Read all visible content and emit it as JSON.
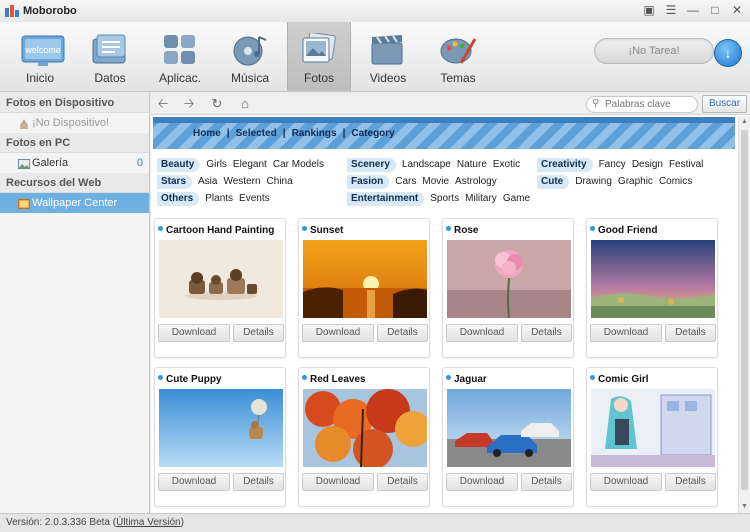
{
  "app": {
    "title": "Moborobo"
  },
  "toolbar": {
    "items": [
      {
        "label": "Inicio",
        "icon": "welcome-icon"
      },
      {
        "label": "Datos",
        "icon": "contacts-icon"
      },
      {
        "label": "Aplicac.",
        "icon": "apps-icon"
      },
      {
        "label": "Música",
        "icon": "music-icon"
      },
      {
        "label": "Fotos",
        "icon": "photos-icon",
        "active": true
      },
      {
        "label": "Videos",
        "icon": "video-icon"
      },
      {
        "label": "Temas",
        "icon": "themes-icon"
      }
    ],
    "tasks_label": "¡No Tarea!",
    "welcome_text": "welcome"
  },
  "sidebar": {
    "sections": [
      {
        "header": "Fotos en Dispositivo",
        "items": [
          {
            "label": "¡No Dispositivo!",
            "icon": "device-icon",
            "disabled": true
          }
        ]
      },
      {
        "header": "Fotos en PC",
        "items": [
          {
            "label": "Galería",
            "icon": "gallery-icon",
            "count": "0"
          }
        ]
      },
      {
        "header": "Recursos del Web",
        "items": [
          {
            "label": "Wallpaper Center",
            "icon": "web-icon",
            "active": true
          }
        ]
      }
    ]
  },
  "search": {
    "placeholder": "Palabras clave",
    "button": "Buscar"
  },
  "banner": {
    "menu": [
      "Home",
      "Selected",
      "Rankings",
      "Category"
    ],
    "sep": "|"
  },
  "categories": [
    {
      "tag": "Beauty",
      "subs": [
        "Girls",
        "Elegant",
        "Car Models"
      ]
    },
    {
      "tag": "Scenery",
      "subs": [
        "Landscape",
        "Nature",
        "Exotic"
      ]
    },
    {
      "tag": "Creativity",
      "subs": [
        "Fancy",
        "Design",
        "Festival"
      ]
    },
    {
      "tag": "Stars",
      "subs": [
        "Asia",
        "Western",
        "China"
      ]
    },
    {
      "tag": "Fasion",
      "subs": [
        "Cars",
        "Movie",
        "Astrology"
      ]
    },
    {
      "tag": "Cute",
      "subs": [
        "Drawing",
        "Graphic",
        "Comics"
      ]
    },
    {
      "tag": "Others",
      "subs": [
        "Plants",
        "Events"
      ]
    },
    {
      "tag": "Entertainment",
      "subs": [
        "Sports",
        "Military",
        "Game"
      ]
    }
  ],
  "cards": [
    {
      "title": "Cartoon Hand Painting",
      "download": "Download",
      "details": "Details"
    },
    {
      "title": "Sunset",
      "download": "Download",
      "details": "Details"
    },
    {
      "title": "Rose",
      "download": "Download",
      "details": "Details"
    },
    {
      "title": "Good Friend",
      "download": "Download",
      "details": "Details"
    },
    {
      "title": "Cute Puppy",
      "download": "Download",
      "details": "Details"
    },
    {
      "title": "Red Leaves",
      "download": "Download",
      "details": "Details"
    },
    {
      "title": "Jaguar",
      "download": "Download",
      "details": "Details"
    },
    {
      "title": "Comic Girl",
      "download": "Download",
      "details": "Details"
    }
  ],
  "status": {
    "version": "Versión: 2.0.3.336 Beta",
    "open": "(",
    "link": "Última Versión",
    "close": ")"
  },
  "colors": {
    "accent": "#6fb0e2",
    "banner": "#5e9fd6",
    "link": "#2f7fd3"
  }
}
